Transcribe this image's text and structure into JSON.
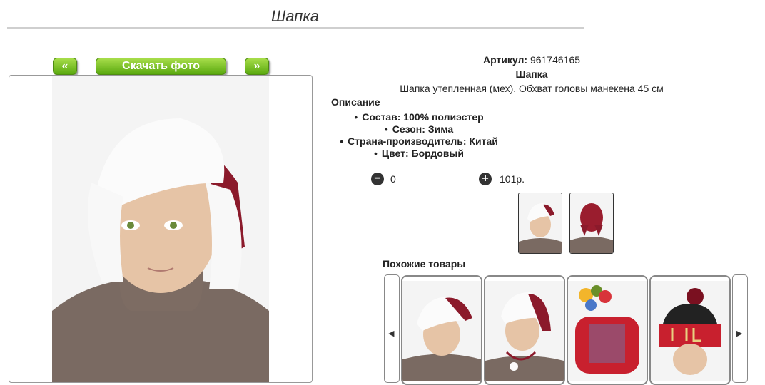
{
  "page": {
    "title": "Шапка"
  },
  "nav": {
    "prev_label": "«",
    "download_label": "Скачать фото",
    "next_label": "»"
  },
  "product": {
    "article_label": "Артикул:",
    "article_value": "961746165",
    "name": "Шапка",
    "description": "Шапка утепленная (мех). Обхват головы манекена 45 см"
  },
  "specs": {
    "title": "Описание",
    "items": [
      "Состав: 100% полиэстер",
      "Сезон: Зима",
      "Страна-производитель: Китай",
      "Цвет: Бордовый"
    ]
  },
  "cart": {
    "minus_icon": "−",
    "plus_icon": "+",
    "quantity": "0",
    "price": "101р."
  },
  "similar": {
    "title": "Похожие товары",
    "left_arrow": "◀",
    "right_arrow": "▶"
  },
  "colors": {
    "accent_green": "#5aa90f",
    "burgundy": "#8b1a2b"
  }
}
